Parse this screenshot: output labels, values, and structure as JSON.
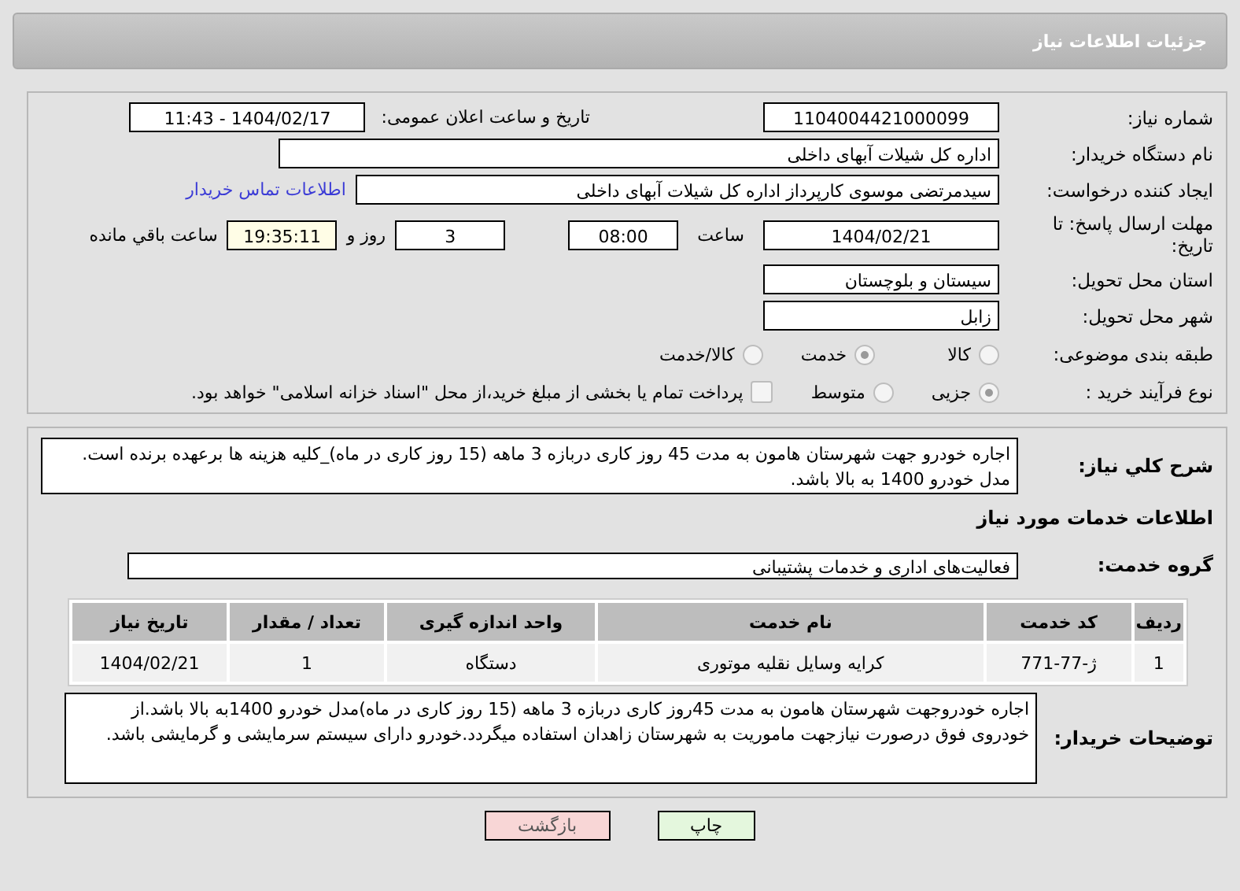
{
  "header": {
    "title": "جزئیات اطلاعات نیاز"
  },
  "details": {
    "need_number": {
      "label": "شماره نیاز:",
      "value": "1104004421000099"
    },
    "announce": {
      "label": "تاریخ و ساعت اعلان عمومی:",
      "value": "1404/02/17 - 11:43"
    },
    "buyer_org": {
      "label": "نام دستگاه خریدار:",
      "value": "اداره کل شیلات آبهای داخلی"
    },
    "creator": {
      "label": "ایجاد کننده درخواست:",
      "value": "سیدمرتضی موسوی کارپرداز اداره کل شیلات آبهای داخلی",
      "link": "اطلاعات تماس خریدار"
    },
    "deadline": {
      "label": "مهلت ارسال پاسخ: تا تاریخ:",
      "date": "1404/02/21",
      "time_label": "ساعت",
      "time": "08:00",
      "days": "3",
      "days_label": "روز و",
      "remaining": "19:35:11",
      "remaining_label": "ساعت باقي مانده"
    },
    "province": {
      "label": "استان محل تحویل:",
      "value": "سیستان و بلوچستان"
    },
    "city": {
      "label": "شهر محل تحویل:",
      "value": "زابل"
    },
    "classification": {
      "label": "طبقه بندی موضوعی:",
      "options": [
        {
          "label": "کالا",
          "selected": false
        },
        {
          "label": "خدمت",
          "selected": true
        },
        {
          "label": "کالا/خدمت",
          "selected": false
        }
      ]
    },
    "process": {
      "label": "نوع فرآیند خرید :",
      "options": [
        {
          "label": "جزیی",
          "selected": true
        },
        {
          "label": "متوسط",
          "selected": false
        }
      ],
      "treasury": {
        "label": "پرداخت تمام یا بخشی از مبلغ خرید،از محل \"اسناد خزانه اسلامی\" خواهد بود.",
        "checked": false
      }
    }
  },
  "needs": {
    "summary": {
      "label": "شرح کلي نياز:",
      "value": "اجاره خودرو جهت شهرستان هامون به مدت 45 روز کاری دربازه 3 ماهه (15 روز کاری در ماه)_کلیه هزینه ها برعهده برنده است. مدل خودرو 1400 به بالا باشد."
    },
    "services_title": "اطلاعات خدمات مورد نیاز",
    "group": {
      "label": "گروه خدمت:",
      "value": "فعالیت‌های اداری و خدمات پشتیبانی"
    },
    "table": {
      "columns": [
        "ردیف",
        "کد خدمت",
        "نام خدمت",
        "واحد اندازه گیری",
        "تعداد / مقدار",
        "تاریخ نیاز"
      ],
      "rows": [
        [
          "1",
          "ژ-77-771",
          "کرایه وسایل نقلیه موتوری",
          "دستگاه",
          "1",
          "1404/02/21"
        ]
      ]
    },
    "buyer_notes": {
      "label": "توضیحات خریدار:",
      "value": "اجاره خودروجهت شهرستان هامون به مدت 45روز کاری دربازه 3 ماهه (15 روز کاری در ماه)مدل خودرو 1400به بالا باشد.از خودروی فوق درصورت نیازجهت ماموریت به  شهرستان زاهدان استفاده میگردد.خودرو دارای سیستم سرمایشی و گرمایشی باشد."
    }
  },
  "buttons": [
    {
      "label": "چاپ",
      "kind": "print"
    },
    {
      "label": "بازگشت",
      "kind": "back"
    }
  ]
}
